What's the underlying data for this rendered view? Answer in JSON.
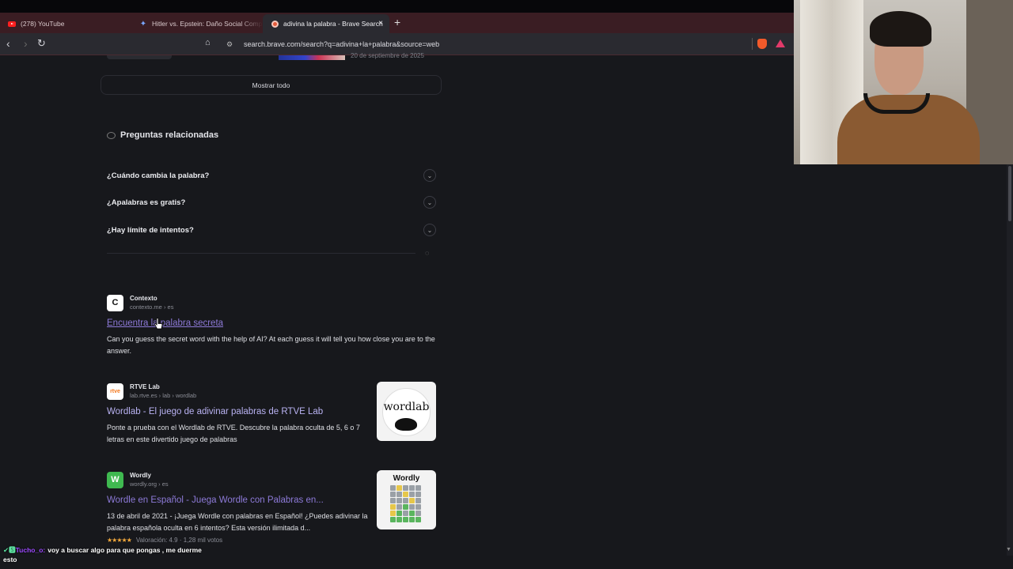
{
  "browser": {
    "tabs": [
      {
        "label": "(278) YouTube",
        "icon": "youtube-icon",
        "active": false
      },
      {
        "label": "Hitler vs. Epstein: Daño Social Comp",
        "icon": "gemini-spark-icon",
        "active": false
      },
      {
        "label": "adivina la palabra - Brave Search",
        "icon": "brave-search-icon",
        "active": true
      }
    ],
    "new_tab": "+",
    "tab_close": "×",
    "url": "search.brave.com/search?q=adivina+la+palabra&source=web"
  },
  "page": {
    "partial_card_date": "20 de septiembre de 2025",
    "show_all_label": "Mostrar todo",
    "related": {
      "heading": "Preguntas relacionadas",
      "questions": [
        "¿Cuándo cambia la palabra?",
        "¿Apalabras es gratis?",
        "¿Hay límite de intentos?"
      ]
    },
    "results": [
      {
        "favicon_letter": "C",
        "site_name": "Contexto",
        "site_url": "contexto.me › es",
        "title": "Encuentra la palabra secreta",
        "description": "Can you guess the secret word with the help of AI? At each guess it will tell you how close you are to the answer."
      },
      {
        "favicon_letter": "rtve",
        "site_name": "RTVE Lab",
        "site_url": "lab.rtve.es › lab › wordlab",
        "title": "Wordlab - El juego de adivinar palabras de RTVE Lab",
        "description": "Ponte a prueba con el Wordlab de RTVE. Descubre la palabra oculta de 5, 6 o 7 letras en este divertido juego de palabras",
        "thumb_text": "wordlab"
      },
      {
        "favicon_letter": "W",
        "site_name": "Wordly",
        "site_url": "wordly.org › es",
        "title": "Wordle en Español - Juega Wordle con Palabras en...",
        "description": "13 de abril de 2021 - ¡Juega Wordle con palabras en Español! ¿Puedes adivinar la palabra española oculta en 6 intentos? Esta versión ilimitada d...",
        "thumb_text": "Wordly",
        "rating_stars": "★★★★★",
        "rating_text": "Valoración: 4.9 · 1,28 mil votos"
      }
    ]
  },
  "chat": {
    "badges": "✔🆂",
    "user": "Tucho_o:",
    "message_line1": "voy a buscar algo para que pongas , me duerme",
    "message_line2": "esto"
  },
  "colors": {
    "tab_bar": "#3a1d23",
    "page_bg": "#17181c",
    "link_visited": "#8d7ad8",
    "link": "#b9b2f2",
    "star": "#f3a93c"
  }
}
